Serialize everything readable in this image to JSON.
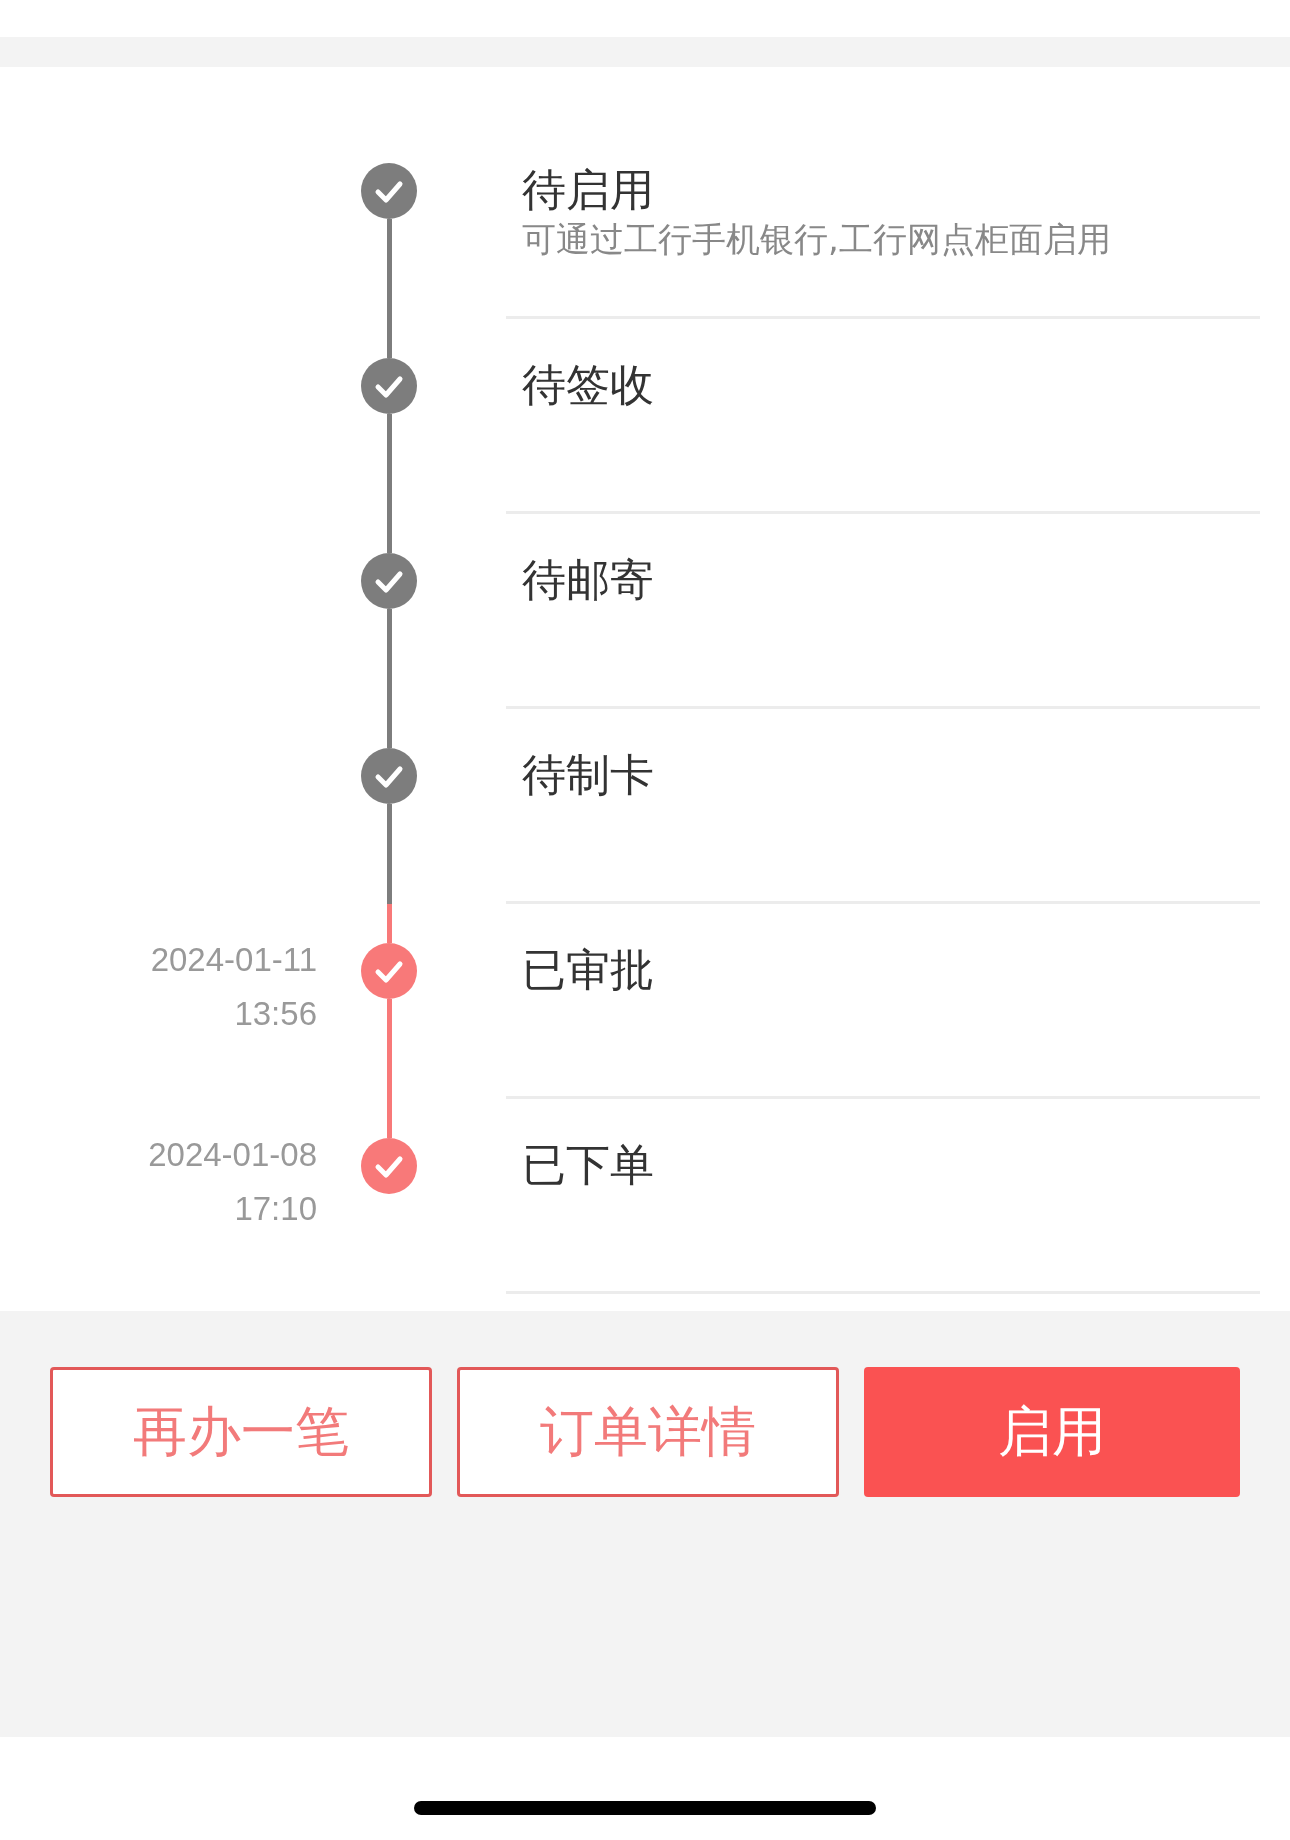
{
  "steps": [
    {
      "title": "待启用",
      "subtitle": "可通过工行手机银行,工行网点柜面启用",
      "completed": false
    },
    {
      "title": "待签收",
      "completed": false
    },
    {
      "title": "待邮寄",
      "completed": false
    },
    {
      "title": "待制卡",
      "completed": false
    },
    {
      "title": "已审批",
      "date": "2024-01-11",
      "time": "13:56",
      "completed": true
    },
    {
      "title": "已下单",
      "date": "2024-01-08",
      "time": "17:10",
      "completed": true
    }
  ],
  "buttons": [
    {
      "label": "再办一笔",
      "kind": "outline"
    },
    {
      "label": "订单详情",
      "kind": "outline"
    },
    {
      "label": "启用",
      "kind": "primary"
    }
  ]
}
